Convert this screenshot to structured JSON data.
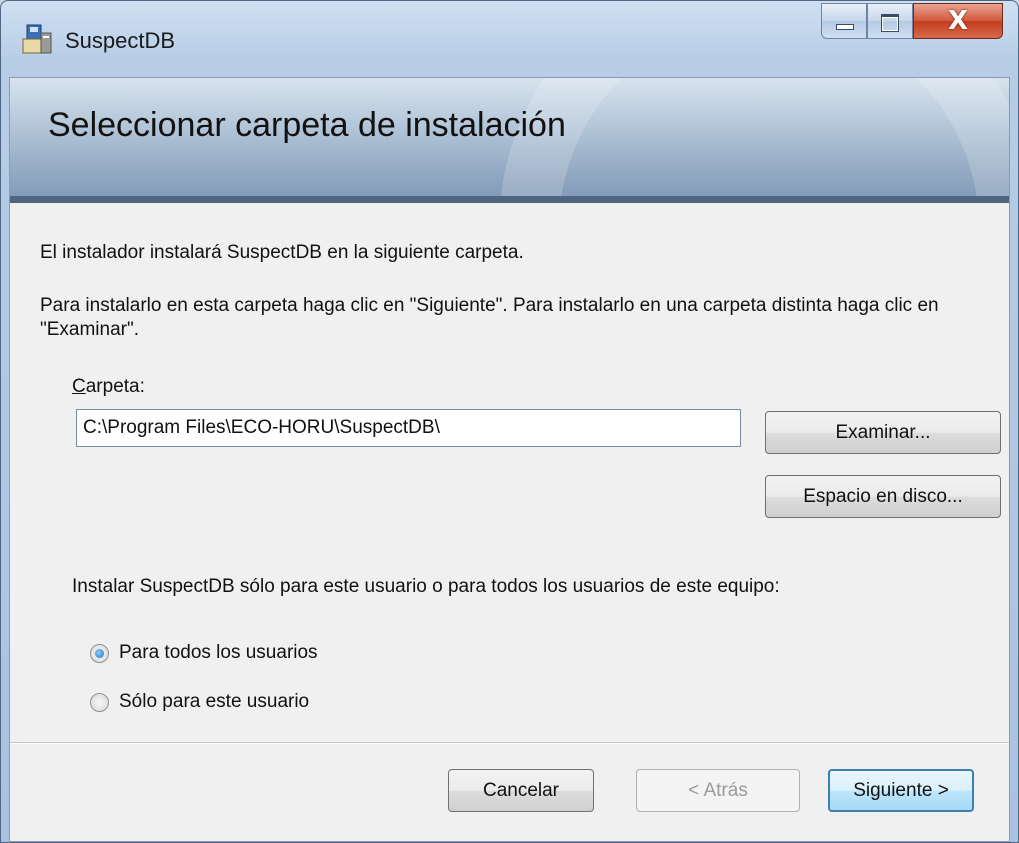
{
  "window": {
    "title": "SuspectDB",
    "controls": {
      "minimize": "minimize",
      "maximize": "maximize",
      "close": "X"
    }
  },
  "banner": {
    "title": "Seleccionar carpeta de instalación"
  },
  "content": {
    "intro": "El instalador instalará SuspectDB en la siguiente carpeta.",
    "description": "Para instalarlo en esta carpeta haga clic en \"Siguiente\". Para instalarlo en una carpeta distinta haga clic en \"Examinar\".",
    "folder_label_accel": "C",
    "folder_label_rest": "arpeta:",
    "folder_value": "C:\\Program Files\\ECO-HORU\\SuspectDB\\",
    "browse_label": "Examinar...",
    "disk_space_label": "Espacio en disco...",
    "install_for_label": "Instalar SuspectDB sólo para este usuario o para todos los usuarios de este equipo:",
    "options": [
      {
        "label": "Para todos los usuarios",
        "selected": true
      },
      {
        "label": "Sólo para este usuario",
        "selected": false
      }
    ]
  },
  "footer": {
    "cancel_label": "Cancelar",
    "back_label": "< Atrás",
    "next_label": "Siguiente >"
  },
  "colors": {
    "banner_line": "#51657e",
    "close_button": "#c23c1c",
    "default_button_border": "#3c7fb1"
  }
}
